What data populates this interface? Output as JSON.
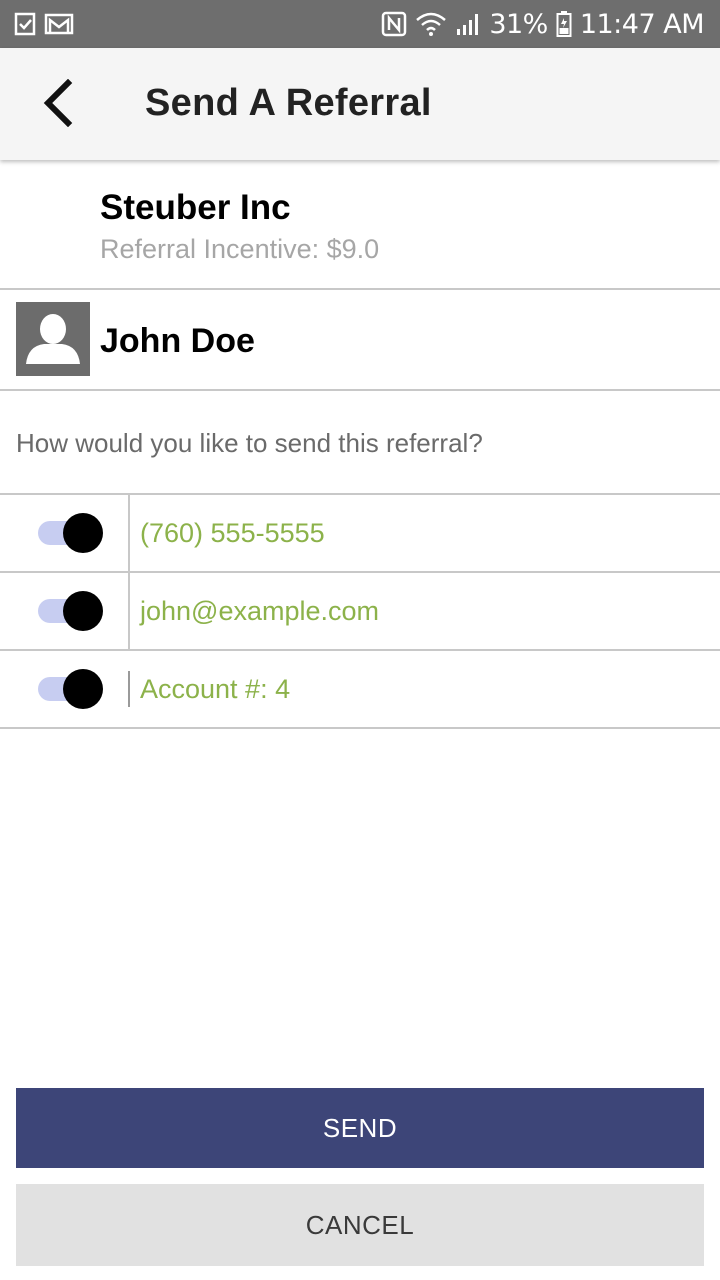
{
  "status_bar": {
    "icons_left": [
      "task-icon",
      "gmail-icon"
    ],
    "icons_right": [
      "nfc-icon",
      "wifi-icon",
      "signal-icon",
      "battery-icon"
    ],
    "battery": "31%",
    "time": "11:47 AM"
  },
  "header": {
    "title": "Send A Referral",
    "back_icon": "back-arrow-icon"
  },
  "company": {
    "name": "Steuber Inc",
    "incentive": "Referral Incentive: $9.0"
  },
  "contact": {
    "name": "John Doe",
    "avatar_icon": "person-icon"
  },
  "question": "How would you like to send this referral?",
  "options": [
    {
      "value": "(760) 555-5555",
      "enabled": true
    },
    {
      "value": "john@example.com",
      "enabled": true
    },
    {
      "value": "Account #: 4",
      "enabled": true
    }
  ],
  "actions": {
    "send_label": "SEND",
    "cancel_label": "CANCEL"
  },
  "colors": {
    "accent": "#3d4578",
    "option_text": "#8cb24a",
    "toggle_track": "#c7cdf1"
  }
}
